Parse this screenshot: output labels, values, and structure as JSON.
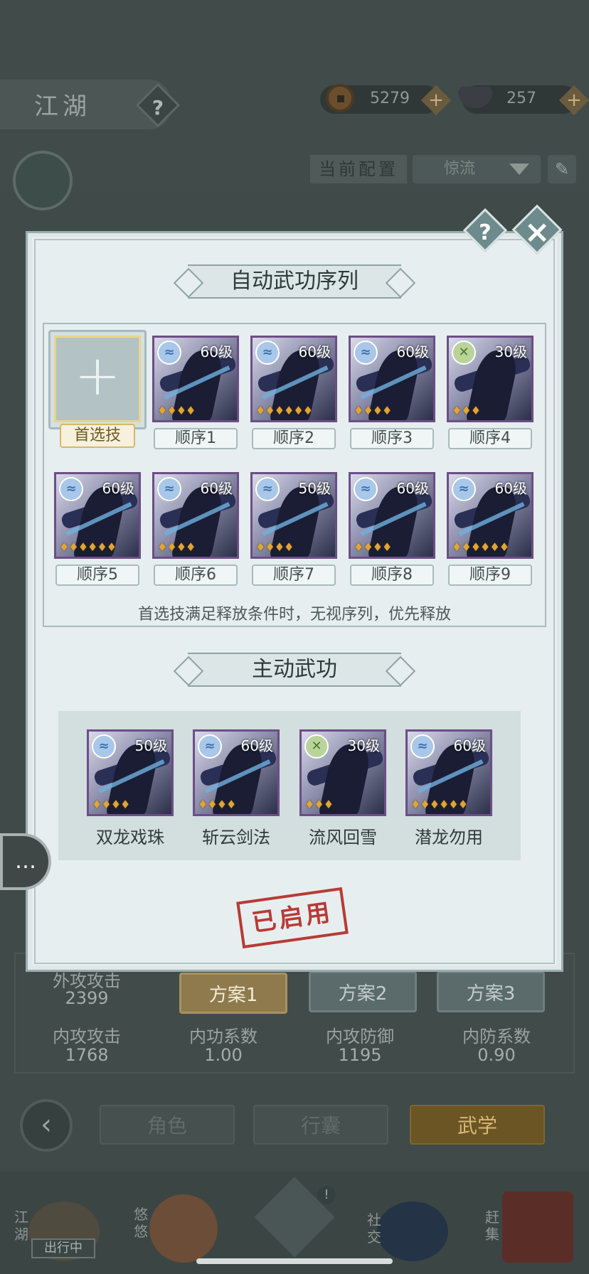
{
  "header": {
    "title": "江湖",
    "help_icon": "question-icon",
    "currencies": [
      {
        "icon": "copper-coin-icon",
        "value": "5279"
      },
      {
        "icon": "silver-ingot-icon",
        "value": "257"
      }
    ],
    "current_config_label": "当前配置",
    "current_config_value": "惊流"
  },
  "background_stats": {
    "plans": [
      "方案1",
      "方案2",
      "方案3"
    ],
    "active_plan": "方案1",
    "stats": [
      {
        "label": "外攻攻击",
        "value": "2399"
      },
      {
        "label": "内攻攻击",
        "value": "1768"
      },
      {
        "label": "内功系数",
        "value": "1.00"
      },
      {
        "label": "内攻防御",
        "value": "1195"
      },
      {
        "label": "内防系数",
        "value": "0.90"
      }
    ]
  },
  "bottom_nav": {
    "tabs": [
      "角色",
      "行囊",
      "武学"
    ],
    "active_tab": "武学",
    "dock": [
      "江湖",
      "悠悠",
      "社交",
      "赶集"
    ],
    "dock_badge": "出行中"
  },
  "modal": {
    "sequence_title": "自动武功序列",
    "preferred_label": "首选技",
    "sequence": [
      {
        "order": "顺序1",
        "level": "60级",
        "element": "water",
        "drops": 4
      },
      {
        "order": "顺序2",
        "level": "60级",
        "element": "water",
        "drops": 6
      },
      {
        "order": "顺序3",
        "level": "60级",
        "element": "water",
        "drops": 4
      },
      {
        "order": "顺序4",
        "level": "30级",
        "element": "wind",
        "drops": 3
      },
      {
        "order": "顺序5",
        "level": "60级",
        "element": "water",
        "drops": 6
      },
      {
        "order": "顺序6",
        "level": "60级",
        "element": "water",
        "drops": 4
      },
      {
        "order": "顺序7",
        "level": "50级",
        "element": "water",
        "drops": 4
      },
      {
        "order": "顺序8",
        "level": "60级",
        "element": "water",
        "drops": 4
      },
      {
        "order": "顺序9",
        "level": "60级",
        "element": "water",
        "drops": 6
      }
    ],
    "hint": "首选技满足释放条件时，无视序列，优先释放",
    "active_title": "主动武功",
    "active_skills": [
      {
        "name": "双龙戏珠",
        "level": "50级",
        "element": "water",
        "drops": 4
      },
      {
        "name": "斩云剑法",
        "level": "60级",
        "element": "water",
        "drops": 4
      },
      {
        "name": "流风回雪",
        "level": "30级",
        "element": "wind",
        "drops": 3
      },
      {
        "name": "潜龙勿用",
        "level": "60级",
        "element": "water",
        "drops": 6
      }
    ],
    "stamp": "已启用"
  },
  "colors": {
    "modal_bg": "#e7eeef",
    "skill_border": "#6c4e86",
    "active_plan": "#8e7a4d",
    "stamp_red": "#b83a35"
  }
}
